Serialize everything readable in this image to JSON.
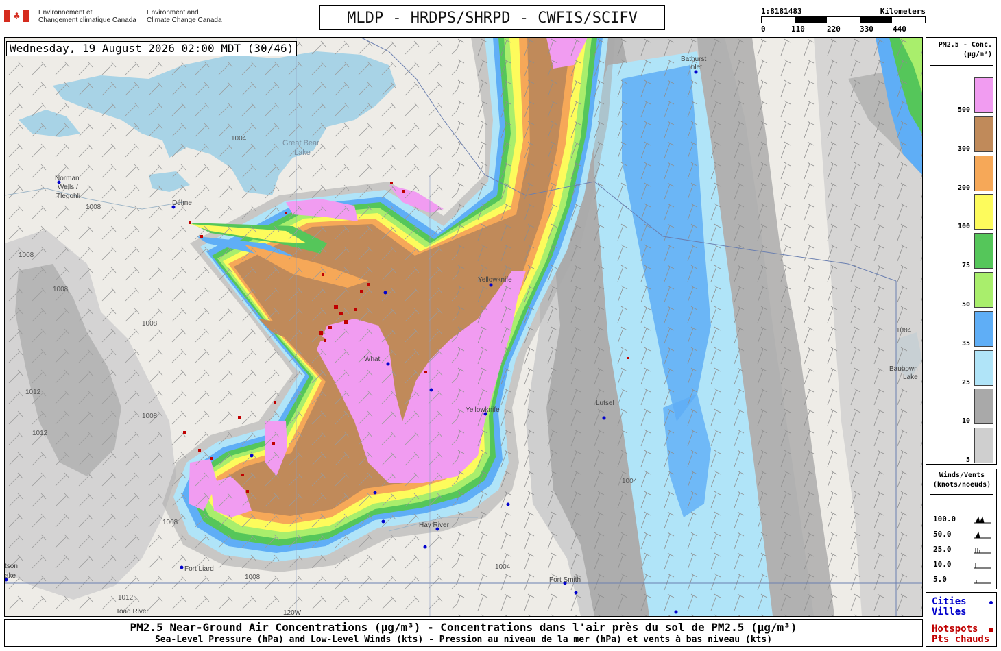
{
  "header": {
    "agency_fr": "Environnement et\nChangement climatique Canada",
    "agency_en": "Environment and\nClimate Change Canada",
    "agency_fr_l1": "Environnement et",
    "agency_fr_l2": "Changement climatique Canada",
    "agency_en_l1": "Environment and",
    "agency_en_l2": "Climate Change Canada",
    "title": "MLDP - HRDPS/SHRPD - CWFIS/SCIFV"
  },
  "scale_bar": {
    "ratio": "1:8181483",
    "unit": "Kilometers",
    "ticks": [
      "0",
      "110",
      "220",
      "330",
      "440"
    ]
  },
  "map": {
    "datetime": "Wednesday, 19 August 2026 02:00 MDT (30/46)",
    "lake_labels": [
      "Great Bear",
      "Lake"
    ],
    "places": {
      "norman_wells": [
        "Norman",
        "Wells /",
        "Tlegohli"
      ],
      "deline": "Délı̨ne",
      "bathurst": [
        "Bathurst",
        "Inlet"
      ],
      "yellowknife": "Yellowknife",
      "behchoko": "Whati",
      "hay_river": "Hay River",
      "fort_liard": "Fort Liard",
      "fort_smith": "Fort Smith",
      "lutselke": "Lutsel",
      "toad_river": "Toad River",
      "watson": [
        "tson",
        "ake"
      ],
      "aberdeen": [
        "Baubown",
        "Lake"
      ],
      "meridian": "120W"
    },
    "isobars": [
      "1004",
      "1008",
      "1012",
      "1008",
      "1004",
      "1008",
      "1008",
      "1008",
      "1004",
      "1012",
      "1008",
      "1008",
      "1012",
      "1004"
    ],
    "colors": {
      "pink": "#f19cf1",
      "brown": "#c08a5a",
      "orange": "#f6a858",
      "yellow": "#fdfb5c",
      "green": "#55c65a",
      "lightgreen": "#a9ee6c",
      "blue": "#5faef6",
      "lightblue": "#b0e4f8",
      "gray": "#a9a9a9",
      "lightgray": "#cfcfcf",
      "hotspot": "#c00000",
      "city": "#0000cc"
    }
  },
  "legend_pm25": {
    "title_line1": "PM2.5 - Conc.",
    "title_line2": "(µg/m³)",
    "levels": [
      {
        "value": "500",
        "color": "#f19cf1"
      },
      {
        "value": "300",
        "color": "#c08a5a"
      },
      {
        "value": "200",
        "color": "#f6a858"
      },
      {
        "value": "100",
        "color": "#fdfb5c"
      },
      {
        "value": "75",
        "color": "#55c65a"
      },
      {
        "value": "50",
        "color": "#a9ee6c"
      },
      {
        "value": "35",
        "color": "#5faef6"
      },
      {
        "value": "25",
        "color": "#b0e4f8"
      },
      {
        "value": "10",
        "color": "#a9a9a9"
      },
      {
        "value": "5",
        "color": "#cfcfcf"
      }
    ]
  },
  "legend_winds": {
    "title_line1": "Winds/Vents",
    "title_line2": "(knots/noeuds)",
    "speeds": [
      "100.0",
      "50.0",
      "25.0",
      "10.0",
      "5.0"
    ]
  },
  "legend_points": {
    "cities_en": "Cities",
    "cities_fr": "Villes",
    "hotspots_en": "Hotspots",
    "hotspots_fr": "Pts chauds"
  },
  "caption": {
    "line1": "PM2.5 Near-Ground Air Concentrations (µg/m³) - Concentrations dans l'air près du sol de PM2.5 (µg/m³)",
    "line2": "Sea-Level Pressure (hPa) and Low-Level Winds (kts) - Pression au niveau de la mer (hPa) et vents à bas niveau (kts)"
  }
}
